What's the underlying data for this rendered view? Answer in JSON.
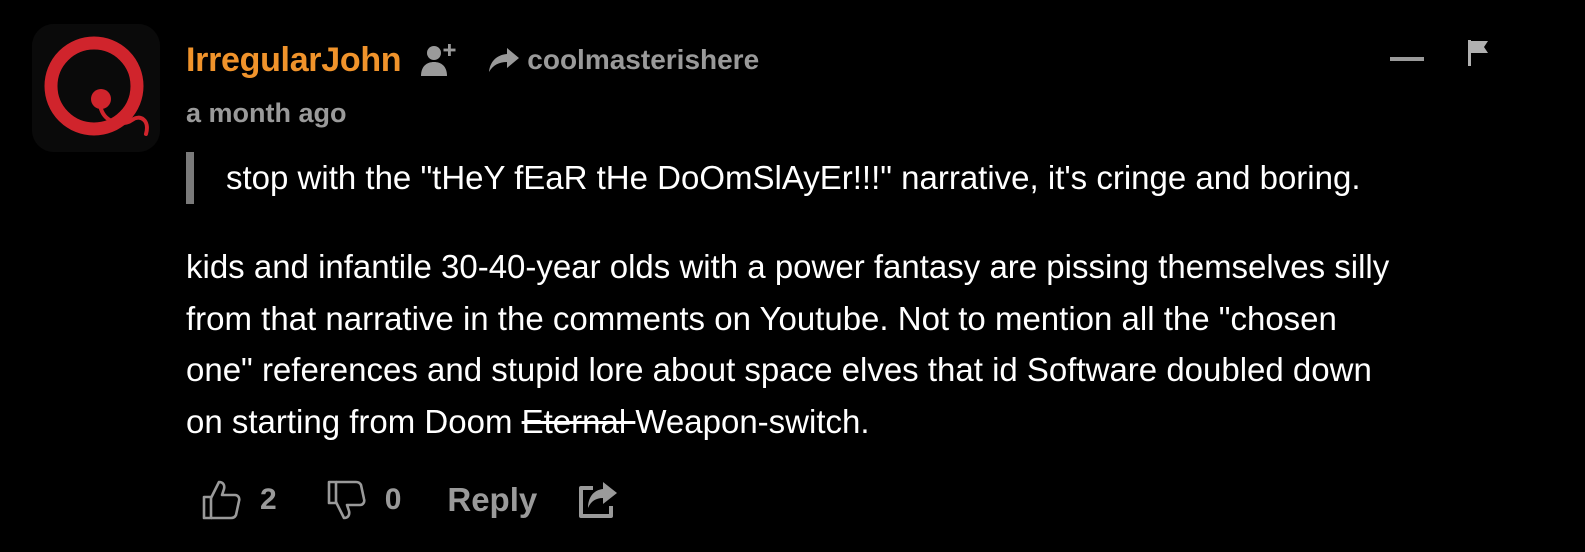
{
  "comment": {
    "author": "IrregularJohn",
    "reply_to": "coolmasterishere",
    "timestamp": "a month ago",
    "quote": "stop with the \"tHeY fEaR tHe DoOmSlAyEr!!!\" narrative, it's cringe and boring.",
    "body": {
      "line1": "kids and infantile 30-40-year olds with a power fantasy are pissing themselves silly",
      "line2": "from that narrative in the comments on Youtube. Not to mention all the \"chosen",
      "line3": "one\" references and stupid lore about space elves that id Software doubled down",
      "line4_prefix": "on starting from Doom ",
      "line4_strike": "Eternal ",
      "line4_suffix": "Weapon-switch."
    },
    "upvotes": "2",
    "downvotes": "0",
    "reply_label": "Reply"
  },
  "icons": {
    "avatar": "red-q-logo-avatar",
    "follow": "add-user-icon",
    "reply_arrow": "reply-arrow-icon",
    "collapse": "minus-icon",
    "flag": "flag-icon",
    "upvote": "thumbs-up-icon",
    "downvote": "thumbs-down-icon",
    "share": "share-icon"
  },
  "colors": {
    "background": "#000000",
    "username": "#f0932b",
    "muted": "#9a9a9a",
    "text": "#ffffff",
    "avatar_red": "#d0242c"
  }
}
